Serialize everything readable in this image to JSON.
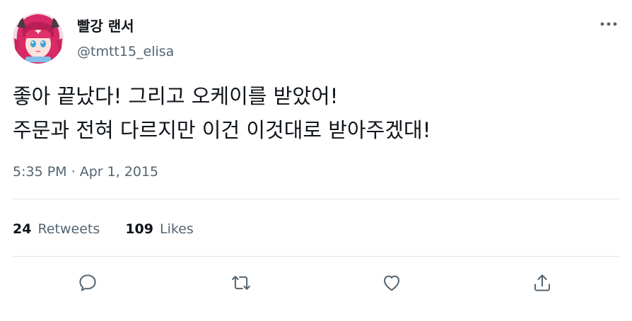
{
  "author": {
    "display_name": "빨강 랜서",
    "handle": "@tmtt15_elisa"
  },
  "tweet": {
    "lines": [
      "좋아 끝났다! 그리고 오케이를 받았어!",
      "주문과 전혀 다르지만 이건 이것대로 받아주겠대!"
    ],
    "time": "5:35 PM",
    "separator": "·",
    "date": "Apr 1, 2015"
  },
  "stats": {
    "retweets_count": "24",
    "retweets_label": "Retweets",
    "likes_count": "109",
    "likes_label": "Likes"
  },
  "icons": {
    "more": "more-horizontal-icon",
    "reply": "reply-icon",
    "retweet": "retweet-icon",
    "like": "heart-icon",
    "share": "share-icon"
  },
  "colors": {
    "text": "#0f1419",
    "secondary": "#536471",
    "divider": "#e2e6ea",
    "avatar_hair": "#e0306a"
  }
}
